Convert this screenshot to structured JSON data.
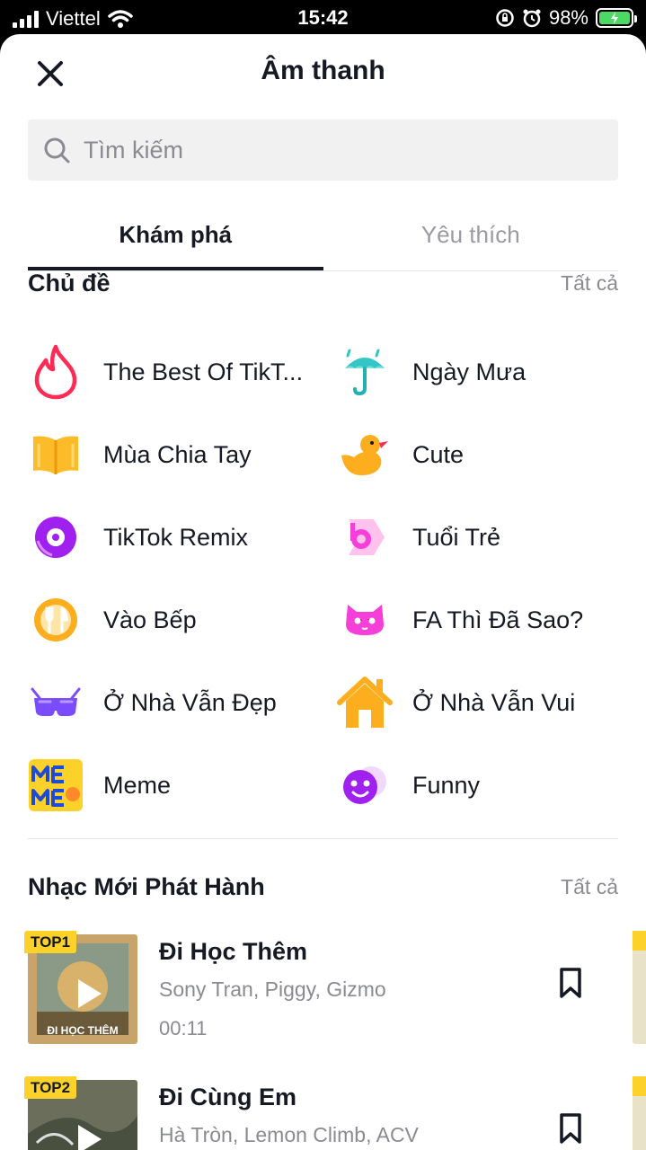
{
  "status_bar": {
    "carrier": "Viettel",
    "time": "15:42",
    "battery": "98%"
  },
  "header": {
    "title": "Âm thanh"
  },
  "search": {
    "placeholder": "Tìm kiếm"
  },
  "tabs": [
    {
      "label": "Khám phá",
      "active": true
    },
    {
      "label": "Yêu thích",
      "active": false
    }
  ],
  "topics_section": {
    "title": "Chủ đề",
    "see_all": "Tất cả",
    "items": [
      {
        "label": "The Best Of TikT...",
        "icon": "flame-icon"
      },
      {
        "label": "Ngày Mưa",
        "icon": "umbrella-icon"
      },
      {
        "label": "Mùa Chia Tay",
        "icon": "book-icon"
      },
      {
        "label": "Cute",
        "icon": "duck-icon"
      },
      {
        "label": "TikTok Remix",
        "icon": "vinyl-icon"
      },
      {
        "label": "Tuổi Trẻ",
        "icon": "youth-icon"
      },
      {
        "label": "Vào Bếp",
        "icon": "cooking-icon"
      },
      {
        "label": "FA Thì Đã Sao?",
        "icon": "cat-icon"
      },
      {
        "label": "Ở Nhà Vẫn Đẹp",
        "icon": "glasses-icon"
      },
      {
        "label": "Ở Nhà Vẫn Vui",
        "icon": "house-icon"
      },
      {
        "label": "Meme",
        "icon": "meme-icon"
      },
      {
        "label": "Funny",
        "icon": "funny-face-icon"
      }
    ]
  },
  "new_releases": {
    "title": "Nhạc Mới Phát Hành",
    "see_all": "Tất cả",
    "songs": [
      {
        "rank": "TOP1",
        "title": "Đi Học Thêm",
        "artists": "Sony Tran, Piggy, Gizmo",
        "duration": "00:11",
        "cover_caption": "ĐI HỌC THÊM"
      },
      {
        "rank": "TOP2",
        "title": "Đi Cùng Em",
        "artists": "Hà Tròn, Lemon Climb, ACV",
        "duration": "",
        "cover_caption": ""
      }
    ]
  },
  "colors": {
    "accent_badge": "#fcd22a",
    "text_primary": "#161823",
    "text_secondary": "#8a8b91",
    "battery_green": "#4cd964"
  }
}
